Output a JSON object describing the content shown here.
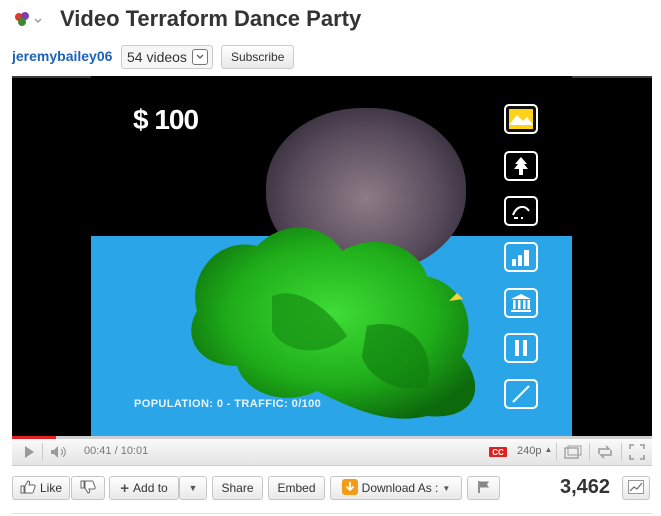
{
  "header": {
    "title": "Video Terraform Dance Party",
    "channel": "jeremybailey06",
    "videos_label": "54 videos",
    "subscribe_label": "Subscribe"
  },
  "video": {
    "hud_money": "$ 100",
    "hud_stats": "POPULATION: 0 - TRAFFIC: 0/100",
    "tools": [
      "terrain-icon",
      "tree-icon",
      "road-icon",
      "building-icon",
      "bank-icon",
      "pause-icon",
      "pencil-icon"
    ]
  },
  "controls": {
    "time": "00:41 / 10:01",
    "cc_label": "CC",
    "quality": "240p",
    "progress": 0.068
  },
  "actions": {
    "like_label": "Like",
    "add_to_label": "Add to",
    "share_label": "Share",
    "embed_label": "Embed",
    "download_label": "Download As :",
    "views": "3,462"
  },
  "colors": {
    "accent": "#1c62b9",
    "progress": "#e02323",
    "water": "#2aa6e8",
    "land": "#22b41e"
  }
}
